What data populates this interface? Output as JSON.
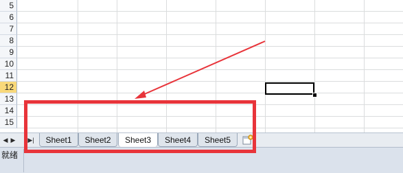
{
  "rows": [
    {
      "num": "5"
    },
    {
      "num": "6"
    },
    {
      "num": "7"
    },
    {
      "num": "8"
    },
    {
      "num": "9"
    },
    {
      "num": "10"
    },
    {
      "num": "11"
    },
    {
      "num": "12",
      "active": true
    },
    {
      "num": "13"
    },
    {
      "num": "14"
    },
    {
      "num": "15"
    }
  ],
  "sheet_tabs": [
    {
      "label": "Sheet1"
    },
    {
      "label": "Sheet2"
    },
    {
      "label": "Sheet3",
      "active": true
    },
    {
      "label": "Sheet4"
    },
    {
      "label": "Sheet5"
    }
  ],
  "nav_buttons": [
    "◀",
    "▶",
    "▶|"
  ],
  "status": {
    "text": "就绪"
  },
  "annotation": {
    "color": "#e8343a"
  }
}
